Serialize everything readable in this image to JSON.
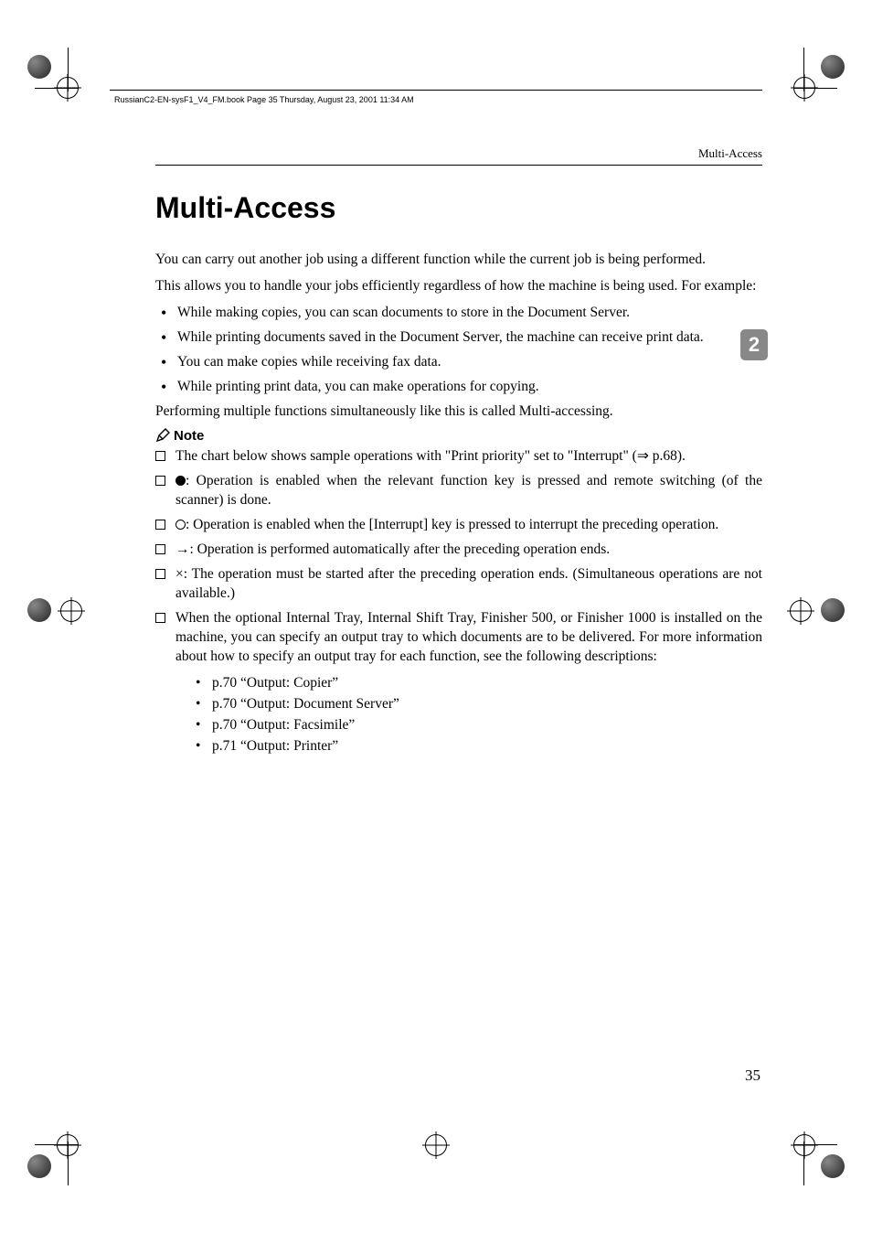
{
  "printmark_header": "RussianC2-EN-sysF1_V4_FM.book  Page 35  Thursday, August 23, 2001  11:34 AM",
  "running_head": "Multi-Access",
  "chapter_num": "2",
  "page_num": "35",
  "title": "Multi-Access",
  "intro1": "You can carry out another job using a different function while the current job is being performed.",
  "intro2": "This allows you to handle your jobs efficiently regardless of how the machine is being used. For example:",
  "bullets": [
    "While making copies, you can scan documents to store in the Document Server.",
    "While printing documents saved in the Document Server, the machine can receive print data.",
    "You can make copies while receiving fax data.",
    "While printing print data, you can make operations for copying."
  ],
  "closing": "Performing multiple functions simultaneously like this is called Multi-accessing.",
  "note_label": "Note",
  "notes": {
    "n1a": "The chart below shows sample operations with \"Print priority\" set to \"Interrupt\" (",
    "n1b": " p.68).",
    "n2": ": Operation is enabled when the relevant function key is pressed and remote switching (of the scanner) is done.",
    "n3": ": Operation is enabled when the [Interrupt] key is pressed to interrupt the preceding operation.",
    "n4": "→: Operation is performed automatically after the preceding operation ends.",
    "n5": "×: The operation must be started after the preceding operation ends.  (Simultaneous operations are not available.)",
    "n6": "When the optional Internal Tray, Internal Shift Tray, Finisher 500, or Finisher 1000 is installed on the machine, you can specify an output tray to which documents are to be delivered.  For more information about how to specify an output tray for each function, see the following descriptions:"
  },
  "sub_bullets": [
    "p.70 “Output: Copier”",
    "p.70 “Output: Document Server”",
    "p.70 “Output: Facsimile”",
    "p.71 “Output: Printer”"
  ]
}
